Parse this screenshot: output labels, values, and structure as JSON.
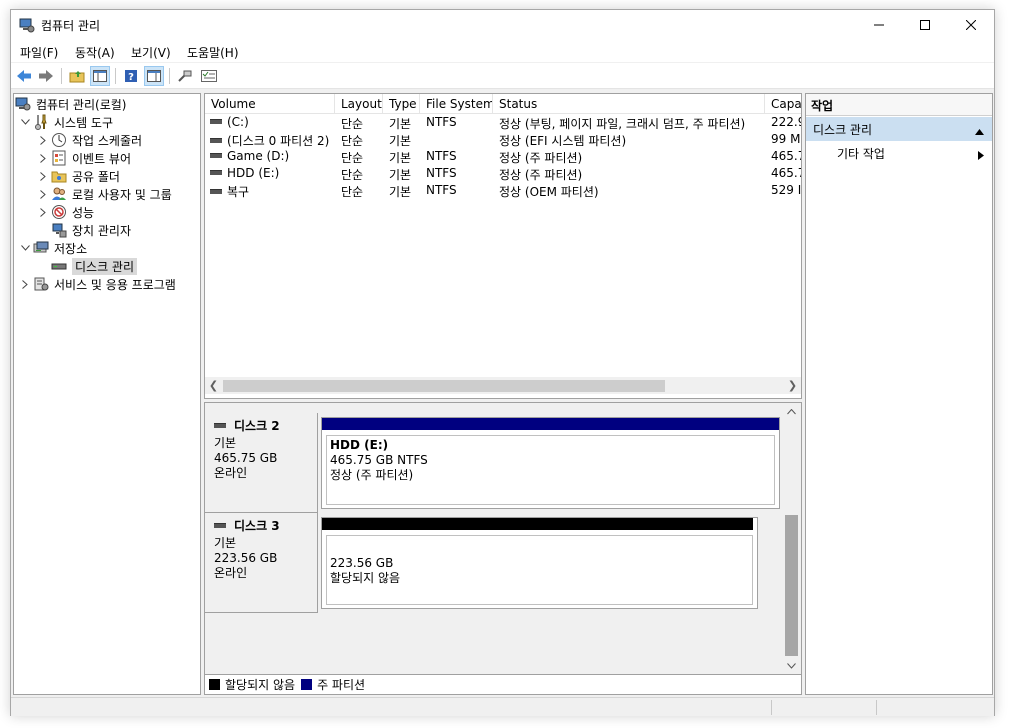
{
  "window": {
    "title": "컴퓨터 관리"
  },
  "menu": [
    "파일(F)",
    "동작(A)",
    "보기(V)",
    "도움말(H)"
  ],
  "tree": {
    "root": "컴퓨터 관리(로컬)",
    "system_tools": "시스템 도구",
    "task_scheduler": "작업 스케줄러",
    "event_viewer": "이벤트 뷰어",
    "shared_folders": "공유 폴더",
    "local_users": "로컬 사용자 및 그룹",
    "performance": "성능",
    "device_manager": "장치 관리자",
    "storage": "저장소",
    "disk_management": "디스크 관리",
    "services": "서비스 및 응용 프로그램"
  },
  "volume_list": {
    "columns": [
      "Volume",
      "Layout",
      "Type",
      "File System",
      "Status",
      "Capa"
    ],
    "rows": [
      {
        "volume": "(C:)",
        "layout": "단순",
        "type": "기본",
        "fs": "NTFS",
        "status": "정상 (부팅, 페이지 파일, 크래시 덤프, 주 파티션)",
        "capacity": "222.9"
      },
      {
        "volume": "(디스크 0 파티션 2)",
        "layout": "단순",
        "type": "기본",
        "fs": "",
        "status": "정상 (EFI 시스템 파티션)",
        "capacity": "99 M"
      },
      {
        "volume": "Game (D:)",
        "layout": "단순",
        "type": "기본",
        "fs": "NTFS",
        "status": "정상 (주 파티션)",
        "capacity": "465.7"
      },
      {
        "volume": "HDD (E:)",
        "layout": "단순",
        "type": "기본",
        "fs": "NTFS",
        "status": "정상 (주 파티션)",
        "capacity": "465.7"
      },
      {
        "volume": "복구",
        "layout": "단순",
        "type": "기본",
        "fs": "NTFS",
        "status": "정상 (OEM 파티션)",
        "capacity": "529 I"
      }
    ]
  },
  "disks": [
    {
      "name": "디스크 2",
      "type": "기본",
      "size": "465.75 GB",
      "state": "온라인",
      "partition": {
        "title": "HDD  (E:)",
        "line1": "465.75 GB NTFS",
        "line2": "정상 (주 파티션)",
        "bar_color": "#000080"
      }
    },
    {
      "name": "디스크 3",
      "type": "기본",
      "size": "223.56 GB",
      "state": "온라인",
      "partition": {
        "title": "",
        "line1": "223.56 GB",
        "line2": "할당되지 않음",
        "bar_color": "#000000"
      }
    }
  ],
  "legend": {
    "unallocated": {
      "label": "할당되지 않음",
      "color": "#000000"
    },
    "primary": {
      "label": "주 파티션",
      "color": "#000080"
    }
  },
  "actions": {
    "header": "작업",
    "section": "디스크 관리",
    "item": "기타 작업"
  }
}
